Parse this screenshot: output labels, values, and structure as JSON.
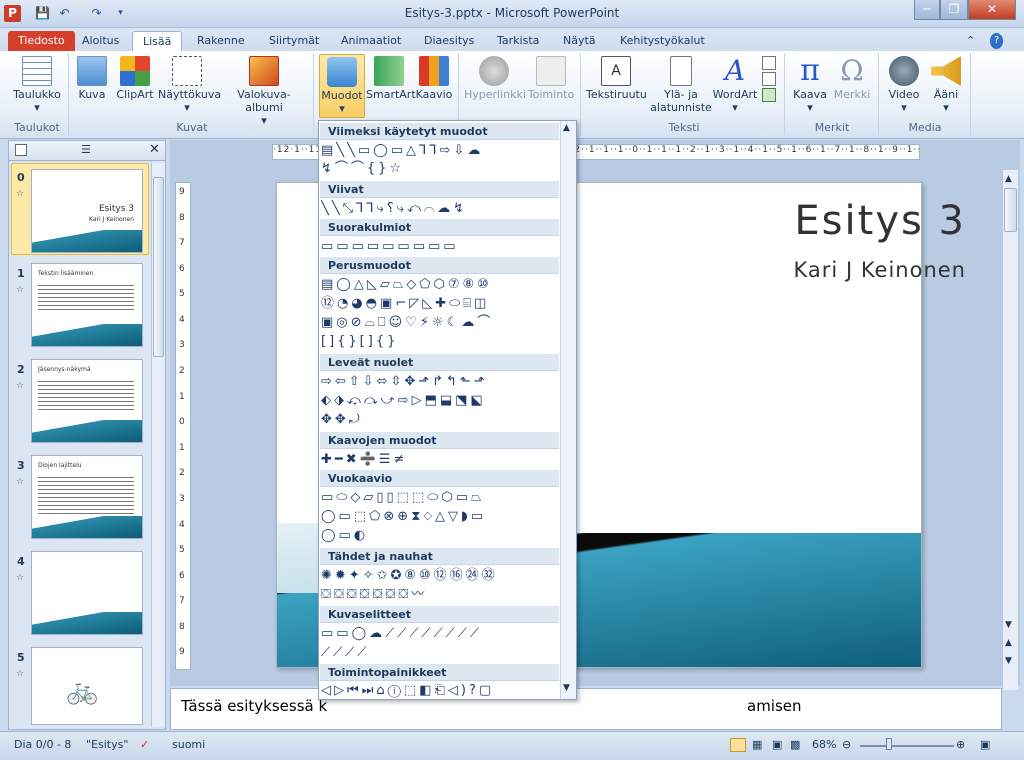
{
  "window": {
    "title": "Esitys-3.pptx - Microsoft PowerPoint",
    "app_letter": "P"
  },
  "colors": {
    "file_tab": "#d6402a",
    "accent": "#2a55a8",
    "slide_blue": "#0d5c78"
  },
  "tabs": [
    {
      "label": "Tiedosto"
    },
    {
      "label": "Aloitus"
    },
    {
      "label": "Lisää"
    },
    {
      "label": "Rakenne"
    },
    {
      "label": "Siirtymät"
    },
    {
      "label": "Animaatiot"
    },
    {
      "label": "Diaesitys"
    },
    {
      "label": "Tarkista"
    },
    {
      "label": "Näytä"
    },
    {
      "label": "Kehitystyökalut"
    }
  ],
  "ribbon": {
    "buttons": [
      {
        "label": "Taulukko"
      },
      {
        "label": "Kuva"
      },
      {
        "label": "ClipArt"
      },
      {
        "label": "Näyttökuva"
      },
      {
        "label": "Valokuva-albumi"
      },
      {
        "label": "Muodot"
      },
      {
        "label": "SmartArt"
      },
      {
        "label": "Kaavio"
      },
      {
        "label": "Hyperlinkki"
      },
      {
        "label": "Toiminto"
      },
      {
        "label": "Tekstiruutu"
      },
      {
        "label": "Ylä- ja"
      },
      {
        "label": "alatunniste"
      },
      {
        "label": "WordArt"
      },
      {
        "label": "Kaava"
      },
      {
        "label": "Merkki"
      },
      {
        "label": "Video"
      },
      {
        "label": "Ääni"
      }
    ],
    "groups": [
      "Taulukot",
      "Kuvat",
      "Teksti",
      "Merkit",
      "Media"
    ]
  },
  "shapes_dropdown": {
    "sections": [
      "Viimeksi käytetyt muodot",
      "Viivat",
      "Suorakulmiot",
      "Perusmuodot",
      "Leveät nuolet",
      "Kaavojen muodot",
      "Vuokaavio",
      "Tähdet ja nauhat",
      "Kuvaselitteet",
      "Toimintopainikkeet"
    ],
    "rows": [
      "▤╲╲▭◯▭△⅂⅂⇨⇩☁",
      "↯⌒⌒{}☆",
      "╲╲⤡⅂⅂⤷⸮⤷⤺⌒☁↯",
      "▭▭▭▭▭▭▭▭▭",
      "▤◯△◺▱⏢◇⬠⬡⑦⑧⑩",
      "⑫◔◕◓▣⌐◸◺✚⬭⌸◫",
      "▣◎⊘⌓⎕☺♡⚡☼☾☁⌒",
      "[]{}[]{}",
      "⇨⇦⇧⇩⬄⇳✥⬏↱↰⬑⬏",
      "⬖⬗⤽⤼⤻⇨▷⬒⬓⬔⬕",
      "✥✥⤾",
      "✚━✖➗☰≠",
      "▭⬭◇▱▯▯⬚⬚⬭⬡▭⏢",
      "◯▭⬚⬠⊗⊕⧗⬦△▽◗▭",
      "◯▭◐",
      "✺✹✦✧✩✪⑧⑩⑫⑯㉔㉜",
      "⛋⛋⛋⛋⛋⛋⛋〰",
      "▭▭◯☁⟋⟋⟋⟋⟋⟋⟋⟋",
      "⟋⟋⟋⟋",
      "◁▷⏮⏭⌂ⓘ⬚◧⎗◁)?▢"
    ]
  },
  "slides": [
    {
      "num": "0",
      "title": "Esitys 3",
      "sub": "Kari J Keinonen"
    },
    {
      "num": "1",
      "title": "Tekstin lisääminen"
    },
    {
      "num": "2",
      "title": "Jäsennys-näkymä"
    },
    {
      "num": "3",
      "title": "Diojen lajittelu"
    },
    {
      "num": "4",
      "title": ""
    },
    {
      "num": "5",
      "title": ""
    }
  ],
  "main_slide": {
    "title": "Esitys 3",
    "subtitle": "Kari J Keinonen"
  },
  "notes_text": "Tässä esityksessä k",
  "notes_tail": "amisen",
  "ruler_h": "·12·1··11·1··10·1··9··1··8··1··7··1··6··1··5··1··4··1··3··1··2··1··1··1··0··1··1··1··2··1··3··1··4··1··5··1··6··1··7··1··8··1··9··1··10··1··11··1··12·",
  "ruler_v": [
    "9",
    "8",
    "7",
    "6",
    "5",
    "4",
    "3",
    "2",
    "1",
    "0",
    "1",
    "2",
    "3",
    "4",
    "5",
    "6",
    "7",
    "8",
    "9"
  ],
  "status": {
    "slide": "Dia 0/0 - 8",
    "theme": "\"Esitys\"",
    "lang": "suomi",
    "zoom": "68%"
  }
}
